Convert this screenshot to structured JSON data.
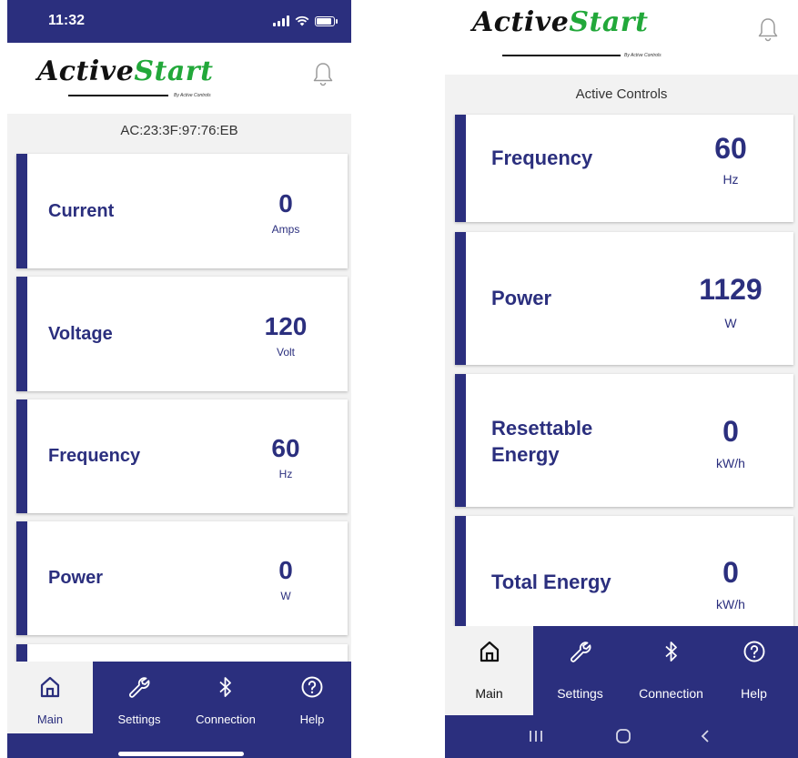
{
  "left": {
    "status": {
      "time": "11:32"
    },
    "logo": {
      "part1": "Active",
      "part2": "Start",
      "tagline": "By Active Controls"
    },
    "subtitle": "AC:23:3F:97:76:EB",
    "cards": [
      {
        "label": "Current",
        "value": "0",
        "unit": "Amps"
      },
      {
        "label": "Voltage",
        "value": "120",
        "unit": "Volt"
      },
      {
        "label": "Frequency",
        "value": "60",
        "unit": "Hz"
      },
      {
        "label": "Power",
        "value": "0",
        "unit": "W"
      }
    ],
    "tabs": [
      {
        "label": "Main",
        "icon": "home-icon",
        "active": true
      },
      {
        "label": "Settings",
        "icon": "wrench-icon",
        "active": false
      },
      {
        "label": "Connection",
        "icon": "bluetooth-icon",
        "active": false
      },
      {
        "label": "Help",
        "icon": "help-icon",
        "active": false
      }
    ]
  },
  "right": {
    "logo": {
      "part1": "Active",
      "part2": "Start",
      "tagline": "By Active Controls"
    },
    "subtitle": "Active Controls",
    "cards": [
      {
        "label": "Frequency",
        "value": "60",
        "unit": "Hz"
      },
      {
        "label": "Power",
        "value": "1129",
        "unit": "W"
      },
      {
        "label_line1": "Resettable",
        "label_line2": "Energy",
        "value": "0",
        "unit": "kW/h"
      },
      {
        "label": "Total Energy",
        "value": "0",
        "unit": "kW/h"
      }
    ],
    "tabs": [
      {
        "label": "Main",
        "icon": "home-icon",
        "active": true
      },
      {
        "label": "Settings",
        "icon": "wrench-icon",
        "active": false
      },
      {
        "label": "Connection",
        "icon": "bluetooth-icon",
        "active": false
      },
      {
        "label": "Help",
        "icon": "help-icon",
        "active": false
      }
    ],
    "android_nav": [
      "recents-icon",
      "home-circle-icon",
      "back-icon"
    ]
  },
  "colors": {
    "primary": "#2b2f7e",
    "brand_green": "#22a83a",
    "background": "#f2f2f2"
  }
}
